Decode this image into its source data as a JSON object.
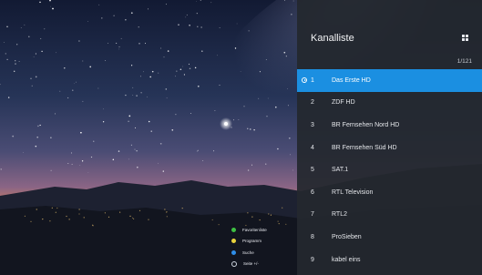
{
  "colors": {
    "panel_bg": "#24282e",
    "selected": "#1b8fe1",
    "legend_red": "#e0334b",
    "legend_green": "#3ec043",
    "legend_yellow": "#e8d23c",
    "legend_blue": "#2f8ee8"
  },
  "legend": {
    "items": [
      {
        "color": "green",
        "label": "Favoritenliste"
      },
      {
        "color": "yellow",
        "label": "Programm"
      },
      {
        "color": "blue",
        "label": "Suche"
      },
      {
        "color": "ring",
        "label": "Seite +/-"
      }
    ]
  },
  "panel": {
    "title": "Kanalliste",
    "page_counter": "1/121",
    "icon": "grid-icon"
  },
  "channels": [
    {
      "number": "1",
      "name": "Das Erste HD",
      "selected": true
    },
    {
      "number": "2",
      "name": "ZDF HD"
    },
    {
      "number": "3",
      "name": "BR Fernsehen Nord HD"
    },
    {
      "number": "4",
      "name": "BR Fernsehen Süd HD"
    },
    {
      "number": "5",
      "name": "SAT.1"
    },
    {
      "number": "6",
      "name": "RTL Television"
    },
    {
      "number": "7",
      "name": "RTL2"
    },
    {
      "number": "8",
      "name": "ProSieben"
    },
    {
      "number": "9",
      "name": "kabel eins"
    }
  ]
}
